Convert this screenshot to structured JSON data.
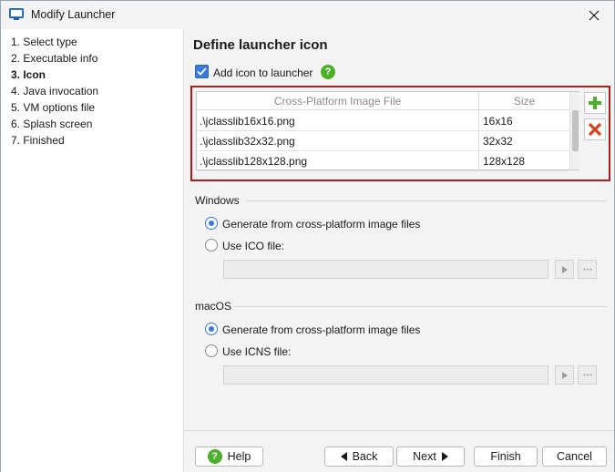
{
  "window": {
    "title": "Modify Launcher"
  },
  "sidebar": {
    "steps": [
      {
        "label": "1. Select type",
        "current": false
      },
      {
        "label": "2. Executable info",
        "current": false
      },
      {
        "label": "3. Icon",
        "current": true
      },
      {
        "label": "4. Java invocation",
        "current": false
      },
      {
        "label": "5. VM options file",
        "current": false
      },
      {
        "label": "6. Splash screen",
        "current": false
      },
      {
        "label": "7. Finished",
        "current": false
      }
    ]
  },
  "content": {
    "heading": "Define launcher icon",
    "add_icon": {
      "label": "Add icon to launcher",
      "checked": true
    },
    "help_glyph": "?",
    "table": {
      "columns": [
        "Cross-Platform Image File",
        "Size"
      ],
      "rows": [
        {
          "file": ".\\jclasslib16x16.png",
          "size": "16x16"
        },
        {
          "file": ".\\jclasslib32x32.png",
          "size": "32x32"
        },
        {
          "file": ".\\jclasslib128x128.png",
          "size": "128x128"
        }
      ]
    },
    "windows": {
      "label": "Windows",
      "option_generate": "Generate from cross-platform image files",
      "option_file": "Use ICO file:",
      "file_value": ""
    },
    "macos": {
      "label": "macOS",
      "option_generate": "Generate from cross-platform image files",
      "option_file": "Use ICNS file:",
      "file_value": ""
    }
  },
  "footer": {
    "help": "Help",
    "back": "Back",
    "next": "Next",
    "finish": "Finish",
    "cancel": "Cancel"
  },
  "colors": {
    "accent": "#3a7ad8",
    "highlight_border": "#b31b1b",
    "add_icon": "#4caf2a",
    "remove_icon": "#d2421b"
  },
  "icons": {
    "add": "plus-icon",
    "remove": "x-icon",
    "browse": "ellipsis-icon",
    "open": "triangle-right-icon"
  }
}
